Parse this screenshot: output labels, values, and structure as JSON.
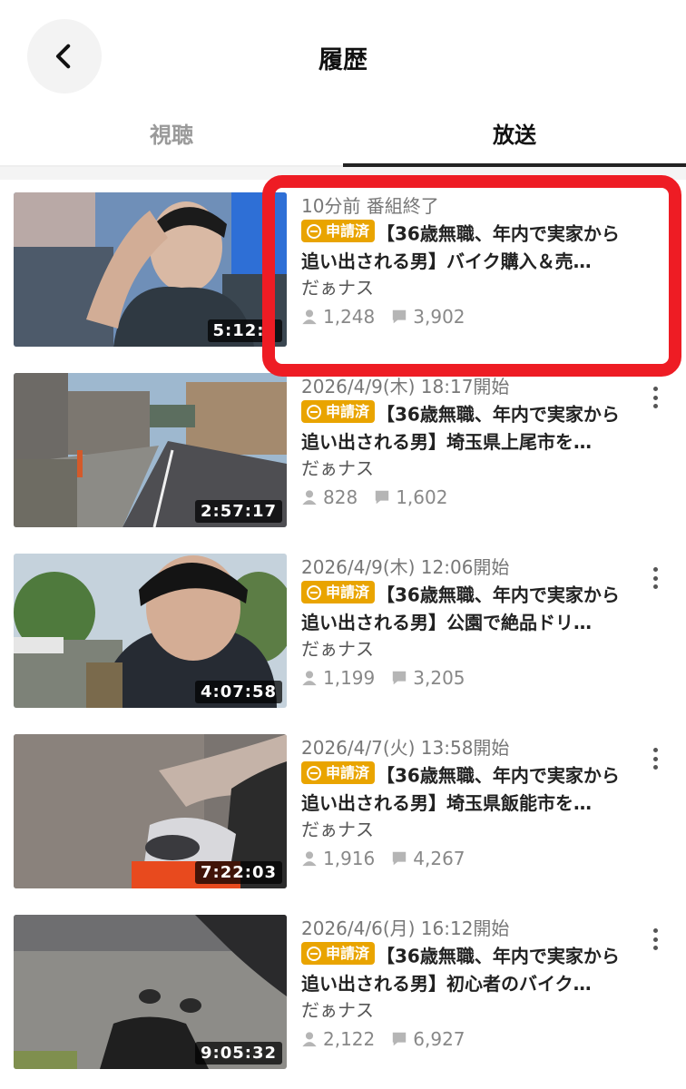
{
  "header": {
    "title": "履歴"
  },
  "tabs": [
    {
      "label": "視聴"
    },
    {
      "label": "放送"
    }
  ],
  "items": [
    {
      "date": "10分前 番組終了",
      "badge": "申請済",
      "title": "【36歳無職、年内で実家から追い出される男】バイク購入＆売…",
      "channel": "だぁナス",
      "viewers": "1,248",
      "comments": "3,902",
      "duration": "5:12:2"
    },
    {
      "date": "2026/4/9(木) 18:17開始",
      "badge": "申請済",
      "title": "【36歳無職、年内で実家から追い出される男】埼玉県上尾市を…",
      "channel": "だぁナス",
      "viewers": "828",
      "comments": "1,602",
      "duration": "2:57:17"
    },
    {
      "date": "2026/4/9(木) 12:06開始",
      "badge": "申請済",
      "title": "【36歳無職、年内で実家から追い出される男】公園で絶品ドリ…",
      "channel": "だぁナス",
      "viewers": "1,199",
      "comments": "3,205",
      "duration": "4:07:58"
    },
    {
      "date": "2026/4/7(火) 13:58開始",
      "badge": "申請済",
      "title": "【36歳無職、年内で実家から追い出される男】埼玉県飯能市を…",
      "channel": "だぁナス",
      "viewers": "1,916",
      "comments": "4,267",
      "duration": "7:22:03"
    },
    {
      "date": "2026/4/6(月) 16:12開始",
      "badge": "申請済",
      "title": "【36歳無職、年内で実家から追い出される男】初心者のバイク…",
      "channel": "だぁナス",
      "viewers": "2,122",
      "comments": "6,927",
      "duration": "9:05:32"
    }
  ],
  "icons": {
    "back": "chevron-left-icon",
    "viewers": "person-icon",
    "comments": "comment-bubble-icon",
    "more": "more-vertical-icon",
    "badge": "coin-icon"
  },
  "colors": {
    "badge": "#e9a400",
    "highlight": "#ee1c24",
    "active_tab_underline": "#222222"
  }
}
